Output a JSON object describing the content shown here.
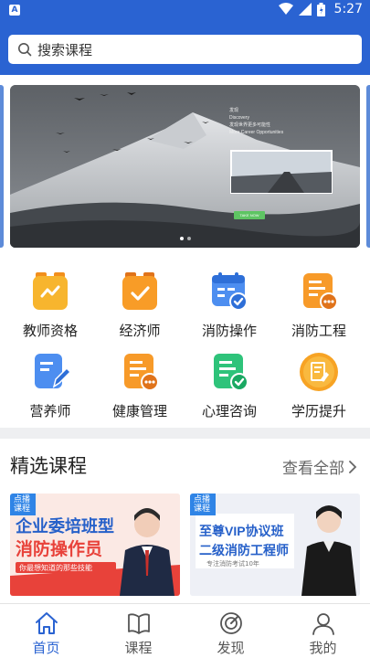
{
  "status": {
    "app_badge": "A",
    "time": "5:27"
  },
  "search": {
    "placeholder": "搜索课程"
  },
  "banner": {
    "overlay_lines": [
      "发现",
      "Discovery",
      "发现世界更多可能性",
      "More Career Opportunities"
    ],
    "button": "TAKE NOW"
  },
  "categories": [
    {
      "label": "教师资格",
      "icon": "teacher-icon",
      "color": "#f7b52e"
    },
    {
      "label": "经济师",
      "icon": "economist-icon",
      "color": "#f89c27"
    },
    {
      "label": "消防操作",
      "icon": "fire-operation-icon",
      "color": "#4d8ef0"
    },
    {
      "label": "消防工程",
      "icon": "fire-engineering-icon",
      "color": "#f79a29"
    },
    {
      "label": "营养师",
      "icon": "nutritionist-icon",
      "color": "#4d8ef0"
    },
    {
      "label": "健康管理",
      "icon": "health-management-icon",
      "color": "#f79a29"
    },
    {
      "label": "心理咨询",
      "icon": "psychology-icon",
      "color": "#2ec37a"
    },
    {
      "label": "学历提升",
      "icon": "education-icon",
      "color": "#f7a324"
    }
  ],
  "featured": {
    "title": "精选课程",
    "more": "查看全部",
    "courses": [
      {
        "badge": "点播课程",
        "line1": "企业委培班型",
        "line2": "消防操作员",
        "sub": "你最想知道的那些技能"
      },
      {
        "badge": "点播课程",
        "line1": "至尊VIP协议班",
        "line2": "二级消防工程师",
        "sub": "专注消防考试10年"
      }
    ]
  },
  "tabs": [
    {
      "label": "首页",
      "icon": "home-icon",
      "active": true
    },
    {
      "label": "课程",
      "icon": "book-icon",
      "active": false
    },
    {
      "label": "发现",
      "icon": "discover-icon",
      "active": false
    },
    {
      "label": "我的",
      "icon": "profile-icon",
      "active": false
    }
  ]
}
